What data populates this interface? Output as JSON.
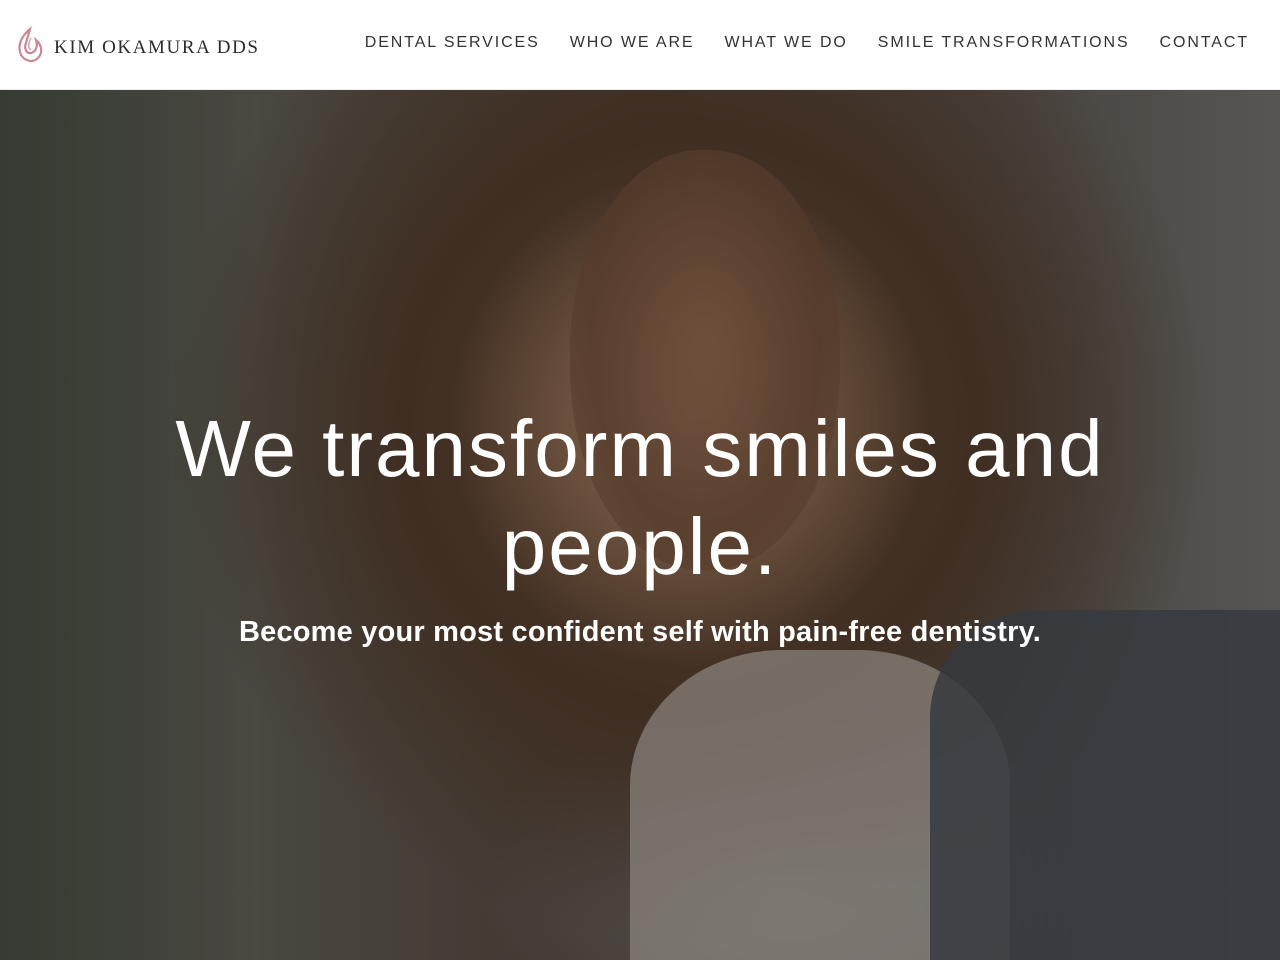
{
  "brand": {
    "name": "KIM OKAMURA DDS",
    "accent_color": "#c98a93"
  },
  "nav": {
    "items": [
      {
        "label": "DENTAL SERVICES"
      },
      {
        "label": "WHO WE ARE"
      },
      {
        "label": "WHAT WE DO"
      },
      {
        "label": "SMILE TRANSFORMATIONS"
      },
      {
        "label": "CONTACT"
      }
    ]
  },
  "hero": {
    "title": "We transform smiles and people.",
    "subtitle": "Become your most confident self with pain-free dentistry."
  }
}
